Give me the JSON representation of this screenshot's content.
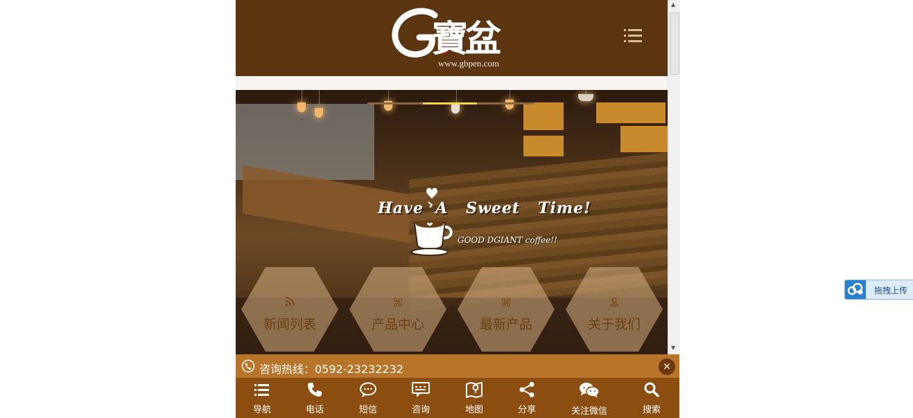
{
  "header": {
    "logo_chars": "寶盆",
    "logo_url": "www.gbpen.com",
    "menu_icon": "menu-icon"
  },
  "banner": {
    "slogan": "Have  A   Sweet   Time!",
    "slogan_sub": "GOOD DGIANT coffee!!",
    "tiles": [
      {
        "icon": "rss-icon",
        "label": "新闻列表"
      },
      {
        "icon": "command-icon",
        "label": "产品中心"
      },
      {
        "icon": "command-icon",
        "label": "最新产品"
      },
      {
        "icon": "user-icon",
        "label": "关于我们"
      }
    ]
  },
  "hotline": {
    "label": "咨询热线：0592-23232232",
    "close": "×"
  },
  "bottom_nav": [
    {
      "icon": "list-icon",
      "label": "导航"
    },
    {
      "icon": "phone-icon",
      "label": "电话"
    },
    {
      "icon": "sms-icon",
      "label": "短信"
    },
    {
      "icon": "chat-icon",
      "label": "咨询"
    },
    {
      "icon": "map-icon",
      "label": "地图"
    },
    {
      "icon": "share-icon",
      "label": "分享"
    },
    {
      "icon": "wechat-icon",
      "label": "关注微信"
    },
    {
      "icon": "search-icon",
      "label": "搜索"
    }
  ],
  "upload_widget": {
    "label": "拖拽上传"
  },
  "colors": {
    "header_bg": "#5b3410",
    "hotline_bg": "#b87429",
    "nav_bg": "#8c4e10"
  }
}
